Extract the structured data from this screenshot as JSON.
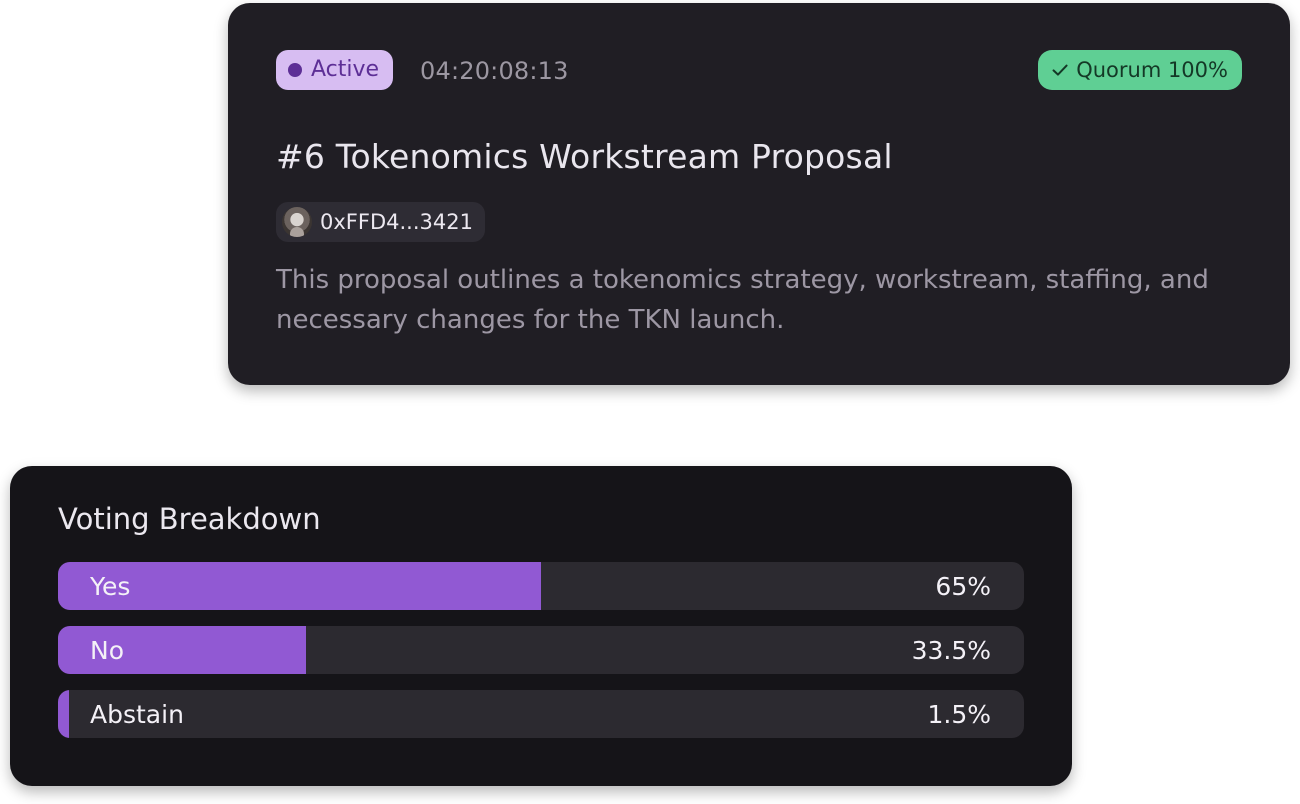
{
  "proposal": {
    "status": "Active",
    "countdown": "04:20:08:13",
    "quorum": "Quorum 100%",
    "title": "#6 Tokenomics Workstream Proposal",
    "author": "0xFFD4...3421",
    "description": "This proposal outlines a tokenomics strategy, workstream, staffing, and necessary changes for the TKN launch."
  },
  "voting": {
    "title": "Voting Breakdown",
    "options": [
      {
        "label": "Yes",
        "percent_text": "65%",
        "percent": 50
      },
      {
        "label": "No",
        "percent_text": "33.5%",
        "percent": 25.7
      },
      {
        "label": "Abstain",
        "percent_text": "1.5%",
        "percent": 1.1
      }
    ]
  },
  "colors": {
    "active_badge": "#d7bdf2",
    "quorum_badge": "#5fcf94",
    "vote_fill": "#9159d3"
  },
  "icons": {
    "status": "status-dot-icon",
    "quorum": "check-icon",
    "author": "avatar"
  }
}
